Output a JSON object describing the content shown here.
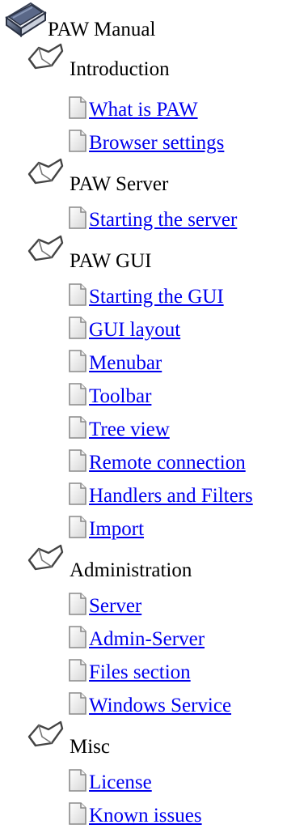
{
  "tree": {
    "root": {
      "label": "PAW Manual",
      "icon": "book-icon"
    },
    "sections": [
      {
        "label": "Introduction",
        "icon": "folder-open-icon",
        "items": [
          {
            "label": " What is PAW",
            "icon": "page-icon"
          },
          {
            "label": " Browser settings",
            "icon": "page-icon"
          }
        ]
      },
      {
        "label": "PAW Server",
        "icon": "folder-open-icon",
        "items": [
          {
            "label": " Starting the server",
            "icon": "page-icon"
          }
        ]
      },
      {
        "label": "PAW GUI",
        "icon": "folder-open-icon",
        "items": [
          {
            "label": " Starting the GUI",
            "icon": "page-icon"
          },
          {
            "label": " GUI layout",
            "icon": "page-icon"
          },
          {
            "label": " Menubar",
            "icon": "page-icon"
          },
          {
            "label": " Toolbar",
            "icon": "page-icon"
          },
          {
            "label": " Tree view",
            "icon": "page-icon"
          },
          {
            "label": " Remote connection",
            "icon": "page-icon"
          },
          {
            "label": " Handlers and Filters",
            "icon": "page-icon"
          },
          {
            "label": " Import",
            "icon": "page-icon"
          }
        ]
      },
      {
        "label": "Administration",
        "icon": "folder-open-icon",
        "items": [
          {
            "label": " Server",
            "icon": "page-icon"
          },
          {
            "label": " Admin-Server",
            "icon": "page-icon"
          },
          {
            "label": " Files section",
            "icon": "page-icon"
          },
          {
            "label": " Windows Service",
            "icon": "page-icon"
          }
        ]
      },
      {
        "label": "Misc",
        "icon": "folder-open-icon",
        "items": [
          {
            "label": " License",
            "icon": "page-icon"
          },
          {
            "label": " Known issues",
            "icon": "page-icon"
          }
        ]
      }
    ]
  },
  "colors": {
    "link": "#0000ee",
    "text": "#000000",
    "background": "#ffffff"
  }
}
